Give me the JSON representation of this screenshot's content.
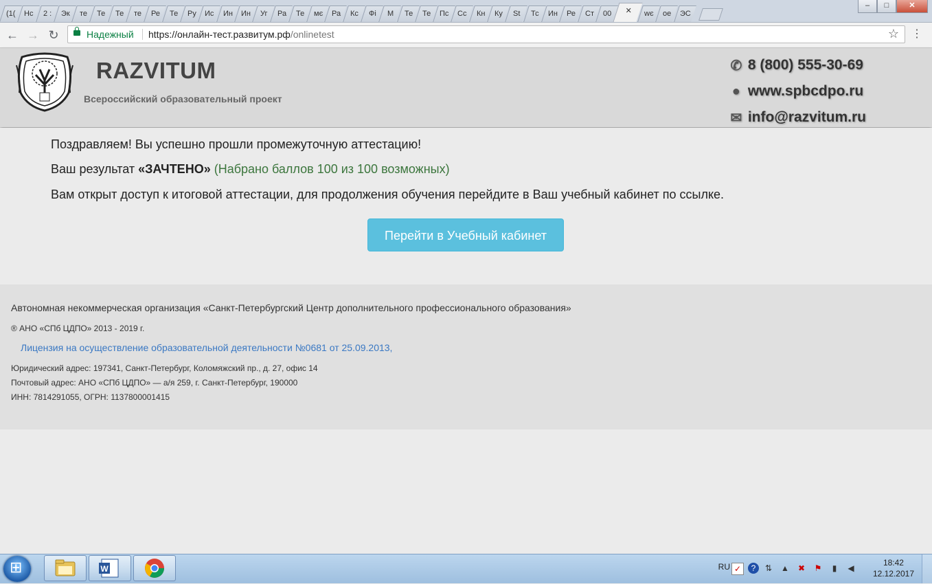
{
  "browser": {
    "tabs": [
      "(1(",
      "Нс",
      "2 :",
      "Эк",
      "те",
      "Те",
      "Те",
      "те",
      "Ре",
      "Те",
      "Ру",
      "Ис",
      "Ин",
      "Ин",
      "Уг",
      "Ра",
      "Те",
      "мє",
      "Ра",
      "Кс",
      "Фі",
      "М",
      "Те",
      "Те",
      "Пс",
      "Сс",
      "Кн",
      "Ку",
      "St",
      "Тс",
      "Ин",
      "Ре",
      "Ст",
      "00",
      "",
      "wє",
      "ое",
      "ЭС"
    ],
    "active_tab_index": 34,
    "active_tab_close": "✕",
    "window_controls": {
      "minimize": "‒",
      "maximize": "□",
      "close": "✕"
    },
    "nav": {
      "back": "←",
      "forward": "→",
      "reload": "↻"
    },
    "secure_label": "Надежный",
    "url_base": "https://онлайн-тест.развитум.рф",
    "url_path": "/onlinetest",
    "star": "☆",
    "menu": "⋮"
  },
  "header": {
    "brand": "RAZVITUM",
    "tagline": "Всероссийский образовательный проект",
    "phone": "8 (800) 555-30-69",
    "site": "www.spbcdpo.ru",
    "email": "info@razvitum.ru",
    "icons": {
      "phone": "phone-icon",
      "globe": "globe-icon",
      "mail": "envelope-icon"
    }
  },
  "main": {
    "congrats": "Поздравляем! Вы успешно прошли промежуточную аттестацию!",
    "result_prefix": "Ваш результат ",
    "result_value": "«ЗАЧТЕНО»",
    "result_score": "(Набрано баллов 100 из 100 возможных)",
    "access_text": "Вам открыт доступ к итоговой аттестации, для продолжения обучения перейдите в Ваш учебный кабинет по ссылке.",
    "button_label": "Перейти в Учебный кабинет",
    "button_color": "#5bc0de"
  },
  "footer": {
    "org": "Автономная некоммерческая организация «Санкт-Петербургский Центр дополнительного профессионального образования»",
    "copyright": "® АНО «СПб ЦДПО» 2013 - 2019 г.",
    "license": "Лицензия на осуществление образовательной деятельности №0681 от 25.09.2013,",
    "legal_address": "Юридический адрес: 197341, Санкт-Петербург, Коломяжский пр., д. 27, офис 14",
    "postal_address": "Почтовый адрес: АНО «СПб ЦДПО» — а/я 259, г. Санкт-Петербург, 190000",
    "ids": "ИНН: 7814291055, ОГРН: 1137800001415"
  },
  "taskbar": {
    "apps": [
      "explorer-icon",
      "word-icon",
      "chrome-icon"
    ],
    "lang": "RU",
    "time": "18:42",
    "date": "12.12.2017"
  }
}
